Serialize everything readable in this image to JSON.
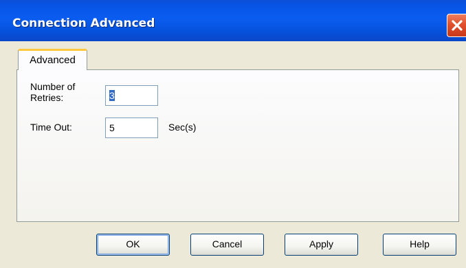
{
  "window": {
    "title": "Connection Advanced",
    "close_icon": "close-icon"
  },
  "tabs": [
    {
      "label": "Advanced",
      "selected": true
    }
  ],
  "form": {
    "retries_label_line1": "Number of",
    "retries_label_line2": "Retries:",
    "retries_value": "3",
    "timeout_label": "Time Out:",
    "timeout_value": "5",
    "timeout_unit": "Sec(s)"
  },
  "buttons": {
    "ok": "OK",
    "cancel": "Cancel",
    "apply": "Apply",
    "help": "Help"
  },
  "colors": {
    "titlebar": "#0a5cf0",
    "close_button": "#e0502a",
    "dialog_bg": "#ece9d8",
    "tab_highlight": "#ffc83c"
  }
}
